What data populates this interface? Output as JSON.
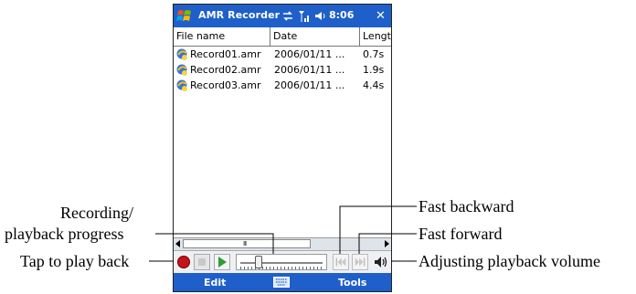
{
  "window": {
    "title": "AMR Recorder",
    "clock": "8:06",
    "close_label": "✕"
  },
  "list": {
    "columns": [
      "File name",
      "Date",
      "Length"
    ],
    "rows": [
      {
        "name": "Record01.amr",
        "date": "2006/01/11 ...",
        "length": "0.7s"
      },
      {
        "name": "Record02.amr",
        "date": "2006/01/11 ...",
        "length": "1.9s"
      },
      {
        "name": "Record03.amr",
        "date": "2006/01/11 ...",
        "length": "4.4s"
      }
    ]
  },
  "scrollbar": {
    "grip": "III"
  },
  "playback": {
    "progress_fraction": 0.2
  },
  "menu": {
    "left": "Edit",
    "right": "Tools"
  },
  "annotations": {
    "progress_line1": "Recording/",
    "progress_line2": "playback progress",
    "tap_play": "Tap to play back",
    "fast_back": "Fast backward",
    "fast_fwd": "Fast forward",
    "volume": "Adjusting playback volume"
  },
  "colors": {
    "titlebar": "#1f5fc9",
    "record": "#c4141b",
    "play": "#2e9e3a"
  },
  "icons": [
    "windows-start-icon",
    "network-icon",
    "signal-icon",
    "speaker-icon",
    "close-icon",
    "sound-file-icon",
    "record-icon",
    "stop-icon",
    "play-icon",
    "fast-backward-icon",
    "fast-forward-icon",
    "volume-icon",
    "keyboard-icon"
  ]
}
